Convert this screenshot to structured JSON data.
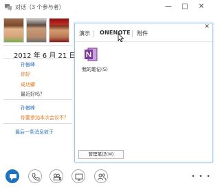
{
  "window": {
    "title": "对话（3 个参与者）",
    "minimize_label": "—",
    "maximize_label": "□",
    "close_label": "✕"
  },
  "conversation": {
    "date": "2012 年 6 月 21 日",
    "messages": [
      {
        "sender": "孙傲峰",
        "text": "你好"
      },
      {
        "sender": "",
        "text": "成功罐"
      },
      {
        "sender": "",
        "text": "最近好吗？"
      },
      {
        "sender": "孙傲峰",
        "text": "你要参加本次会议不？"
      }
    ],
    "last_message_note": "最后一条消息收于"
  },
  "onenote_panel": {
    "close_label": "✕",
    "tabs": [
      {
        "label": "演示"
      },
      {
        "label": "ONENOTE"
      },
      {
        "label": "附件"
      }
    ],
    "active_tab": "ONENOTE",
    "notebook_label": "我的笔记(S)",
    "manage_button_label": "管理笔记(M)"
  },
  "toolbar": {
    "buttons": [
      {
        "icon": "im-bubble-icon",
        "active": true
      },
      {
        "icon": "phone-icon",
        "active": false
      },
      {
        "icon": "video-icon",
        "active": false
      },
      {
        "icon": "present-screen-icon",
        "active": false
      },
      {
        "icon": "participants-icon",
        "active": false
      }
    ],
    "more_label": "• • •"
  },
  "colors": {
    "accent_blue": "#1e73be",
    "link_blue": "#2e75b6",
    "orange_text": "#e0761c",
    "onenote_purple": "#7b3a98",
    "panel_border": "#9cc6e8"
  }
}
